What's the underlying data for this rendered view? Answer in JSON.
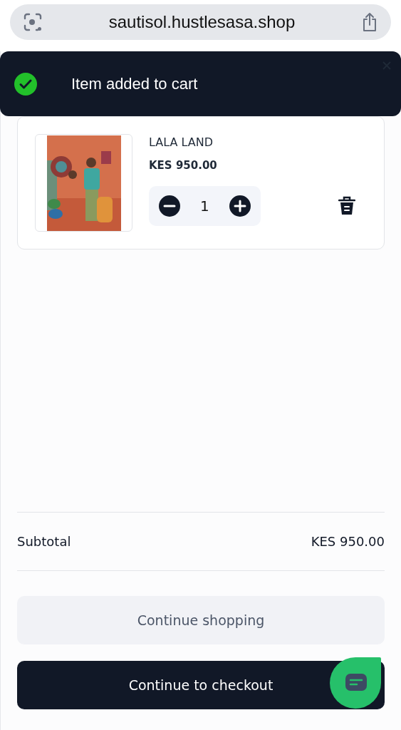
{
  "browser": {
    "address": "sautisol.hustlesasa.shop"
  },
  "toast": {
    "message": "Item added to cart"
  },
  "cart_items": [
    {
      "name": "LALA LAND",
      "price": "KES 950.00",
      "quantity": "1"
    }
  ],
  "subtotal": {
    "label": "Subtotal",
    "value": "KES 950.00"
  },
  "buttons": [
    {
      "label": "Continue shopping",
      "kind": "secondary"
    },
    {
      "label": "Continue to checkout",
      "kind": "primary"
    }
  ]
}
